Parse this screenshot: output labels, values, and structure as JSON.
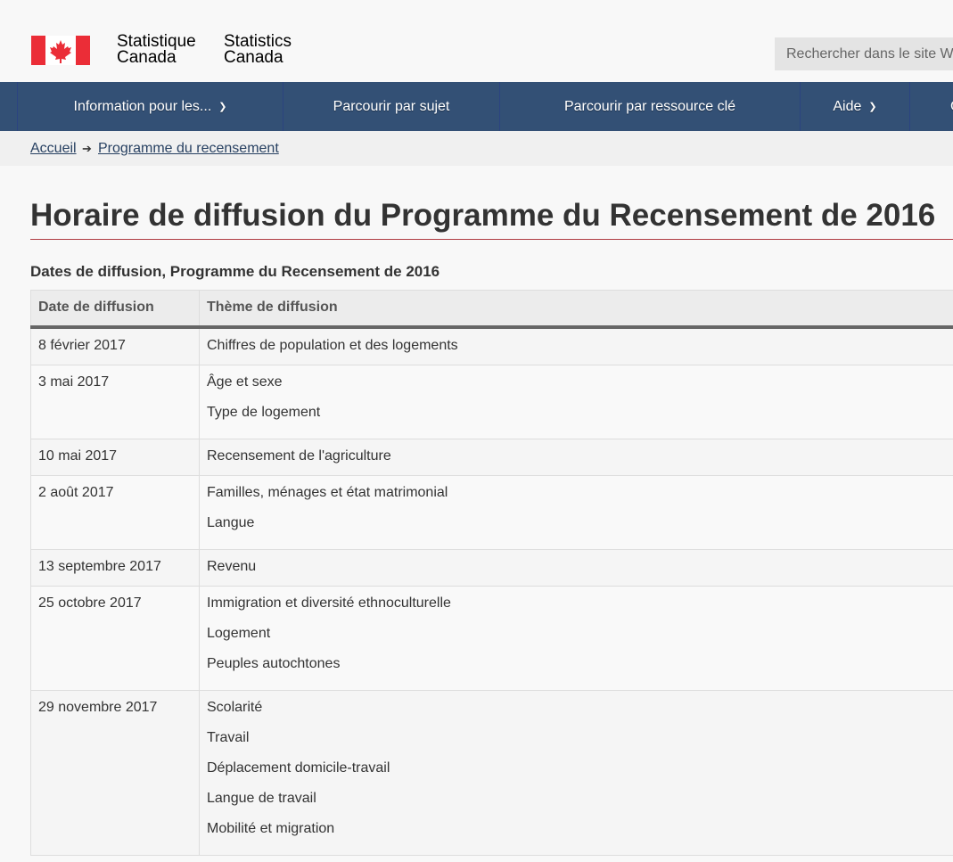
{
  "header": {
    "flag_icon": "canada-flag-icon",
    "signature_fr": [
      "Statistique",
      "Canada"
    ],
    "signature_en": [
      "Statistics",
      "Canada"
    ],
    "search_placeholder": "Rechercher dans le site Web"
  },
  "nav": {
    "items": [
      {
        "label": "Information pour les...",
        "has_chevron": true
      },
      {
        "label": "Parcourir par sujet",
        "has_chevron": false
      },
      {
        "label": "Parcourir par ressource clé",
        "has_chevron": false
      },
      {
        "label": "Aide",
        "has_chevron": true
      },
      {
        "label": "C",
        "has_chevron": false
      }
    ]
  },
  "breadcrumb": {
    "home": "Accueil",
    "arrow": "➔",
    "current": "Programme du recensement"
  },
  "page_title": "Horaire de diffusion du Programme du Recensement de 2016",
  "table": {
    "caption": "Dates de diffusion, Programme du Recensement de 2016",
    "headers": [
      "Date de diffusion",
      "Thème de diffusion"
    ],
    "rows": [
      {
        "date": "8 février 2017",
        "themes": [
          "Chiffres de population et des logements"
        ]
      },
      {
        "date": "3 mai 2017",
        "themes": [
          "Âge et sexe",
          "Type de logement"
        ]
      },
      {
        "date": "10 mai 2017",
        "themes": [
          "Recensement de l'agriculture"
        ]
      },
      {
        "date": "2 août 2017",
        "themes": [
          "Familles, ménages et état matrimonial",
          "Langue"
        ]
      },
      {
        "date": "13 septembre 2017",
        "themes": [
          "Revenu"
        ]
      },
      {
        "date": "25 octobre 2017",
        "themes": [
          "Immigration et diversité ethnoculturelle",
          "Logement",
          "Peuples autochtones"
        ]
      },
      {
        "date": "29 novembre 2017",
        "themes": [
          "Scolarité",
          "Travail",
          "Déplacement domicile-travail",
          "Langue de travail",
          "Mobilité et migration"
        ]
      }
    ]
  },
  "colors": {
    "nav_bg": "#335075",
    "title_rule": "#af3c43",
    "link": "#284162",
    "flag_red": "#eb2d37"
  }
}
